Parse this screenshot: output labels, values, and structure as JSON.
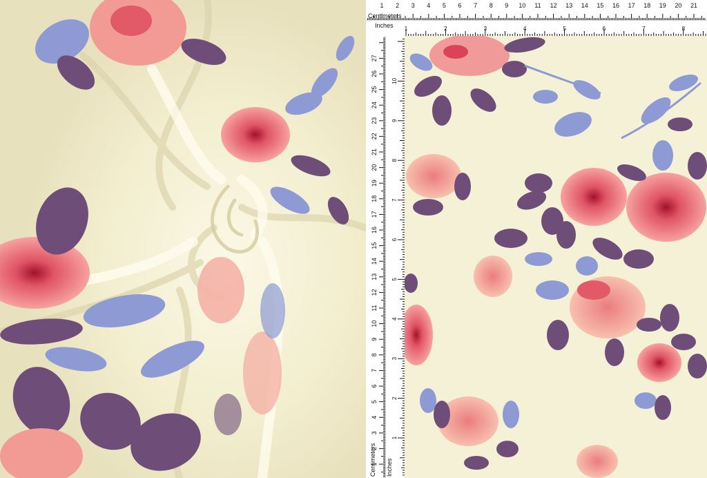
{
  "ruler_top": {
    "cm_label": "Centimeters",
    "in_label": "Inches",
    "cm_marks": [
      "1",
      "2",
      "3",
      "4",
      "5",
      "6",
      "7",
      "8",
      "9",
      "10",
      "11",
      "12",
      "13",
      "14",
      "15",
      "16",
      "17",
      "18",
      "19",
      "20",
      "21"
    ],
    "in_marks": [
      "1",
      "2",
      "3",
      "4",
      "5",
      "6",
      "7",
      "8"
    ]
  },
  "ruler_left": {
    "cm_label": "Centimeters",
    "in_label": "Inches",
    "cm_marks": [
      "1",
      "2",
      "3",
      "4",
      "5",
      "6",
      "7",
      "8",
      "9",
      "10",
      "11",
      "12",
      "13",
      "14",
      "15",
      "16",
      "17",
      "18",
      "19",
      "20",
      "21",
      "22",
      "23",
      "24",
      "25",
      "26",
      "27"
    ],
    "in_marks": [
      "1",
      "2",
      "3",
      "4",
      "5",
      "6",
      "7",
      "8",
      "9",
      "10"
    ]
  },
  "colors": {
    "fabric_base": "#f7f3da",
    "rose_pink": "#ee7c86",
    "rose_deep": "#c8283f",
    "rose_peach": "#f4a596",
    "leaf_plum": "#6e4e79",
    "leaf_lavender": "#8f9bd4",
    "ruler": "#ffffff"
  }
}
